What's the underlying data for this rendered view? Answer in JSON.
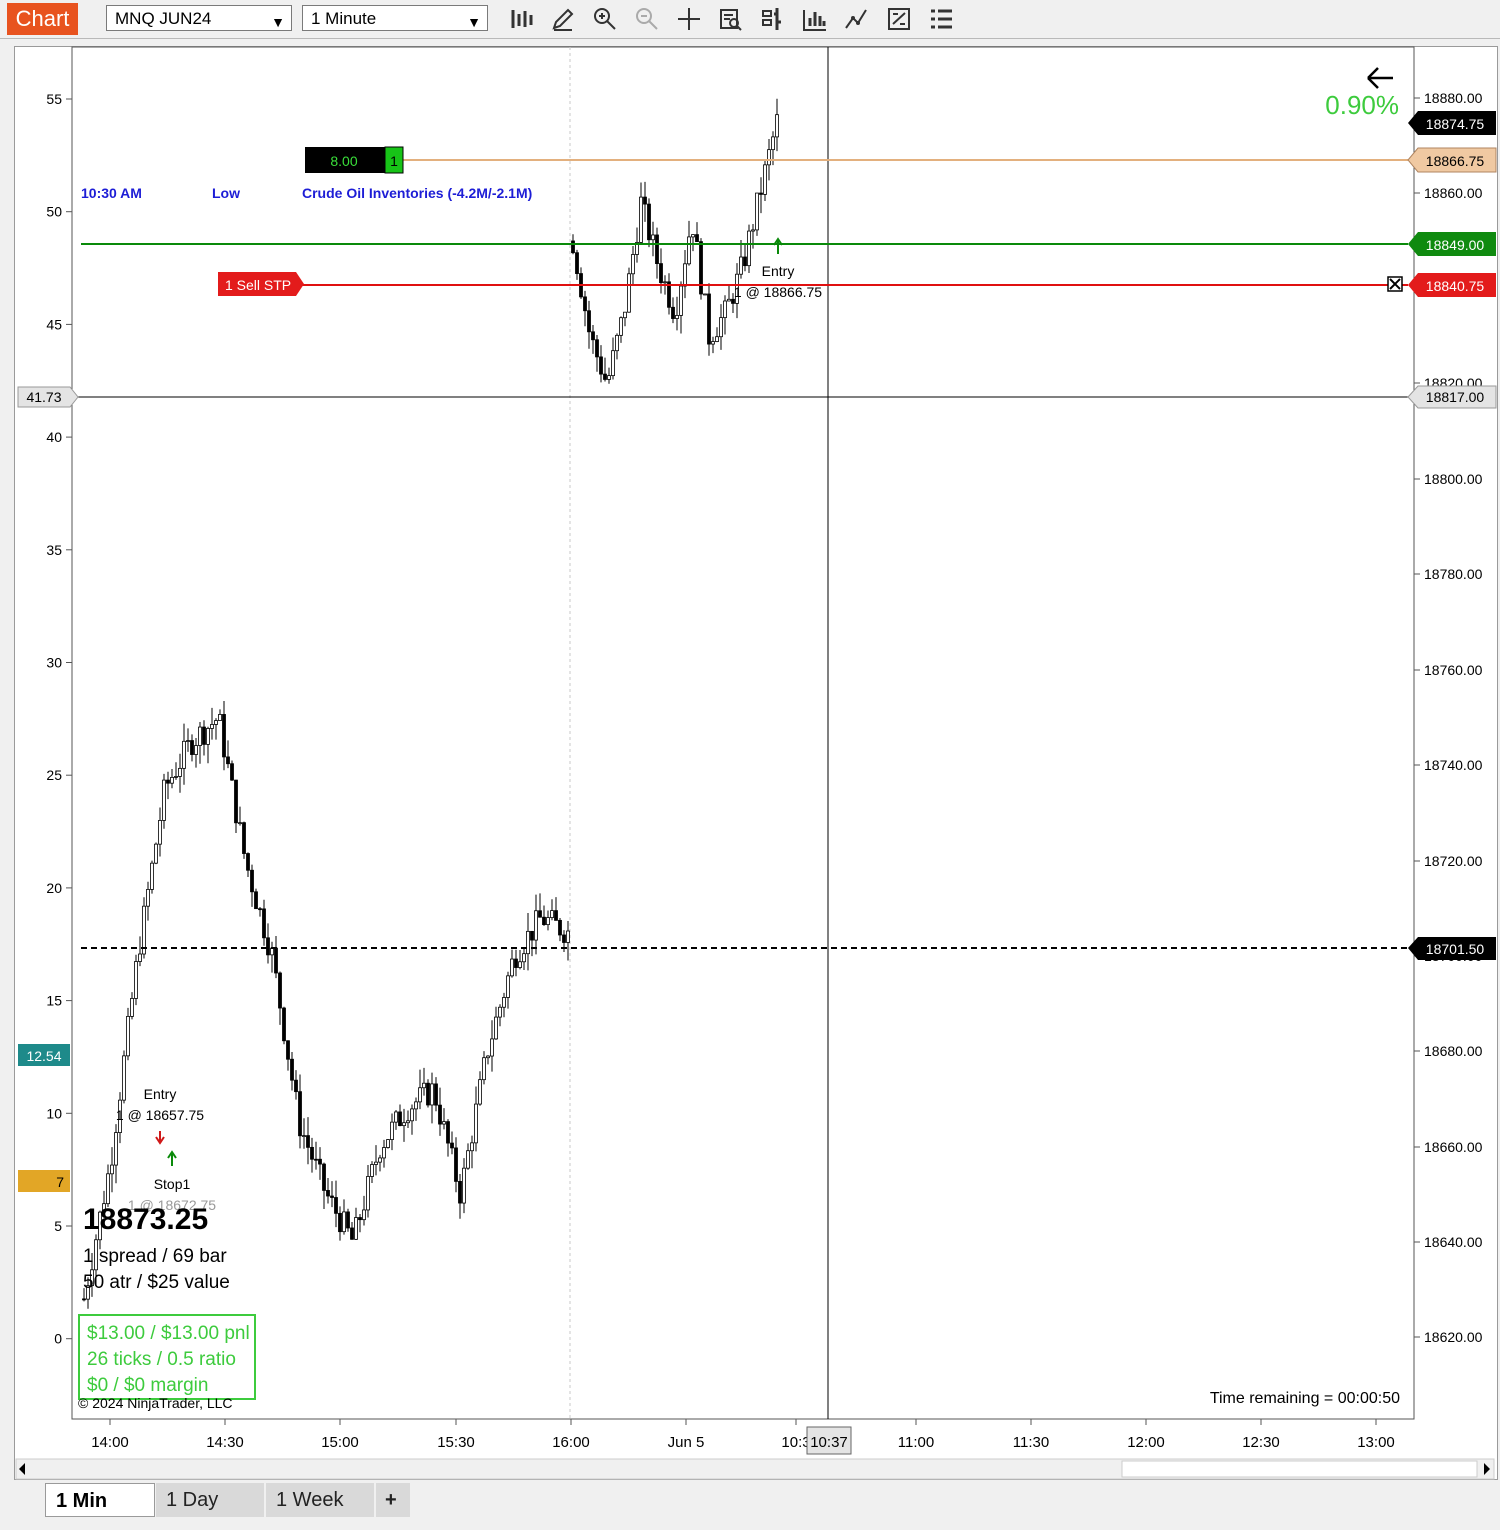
{
  "toolbar": {
    "chart_label": "Chart",
    "instrument": "MNQ JUN24",
    "interval": "1 Minute",
    "icons": [
      "bar-type-icon",
      "draw-pencil-icon",
      "zoom-in-icon",
      "zoom-out-icon",
      "crosshair-icon",
      "data-box-icon",
      "chart-style-icon",
      "volume-bars-icon",
      "indicators-icon",
      "strategies-icon",
      "properties-icon"
    ]
  },
  "chart": {
    "pct_change": "0.90%",
    "left_axis_ticks": [
      "55",
      "50",
      "45",
      "40",
      "35",
      "30",
      "25",
      "20",
      "15",
      "10",
      "5",
      "0"
    ],
    "left_markers": {
      "crosshair": "41.73",
      "teal": "12.54",
      "gold": "7"
    },
    "right_axis_ticks": [
      "18880.00",
      "18860.00",
      "18820.00",
      "18800.00",
      "18780.00",
      "18760.00",
      "18740.00",
      "18720.00",
      "18700.00",
      "18680.00",
      "18660.00",
      "18640.00",
      "18620.00"
    ],
    "right_markers": {
      "last": "18874.75",
      "target": "18866.75",
      "stop": "18849.00",
      "sell_stp": "18840.75",
      "crosshair": "18817.00",
      "prior_close": "18701.50"
    },
    "x_ticks": [
      "14:00",
      "14:30",
      "15:00",
      "15:30",
      "16:00",
      "Jun 5",
      "10:3",
      "11:00",
      "11:30",
      "12:00",
      "12:30",
      "13:00"
    ],
    "x_crosshair": "10:37",
    "news": {
      "time": "10:30 AM",
      "impact": "Low",
      "event": "Crude Oil Inventories (-4.2M/-2.1M)"
    },
    "target_order": {
      "value": "8.00",
      "qty": "1"
    },
    "stop_order": "1 Sell STP",
    "entry1": {
      "label": "Entry",
      "detail": "1 @ 18657.75"
    },
    "stop1": {
      "label": "Stop1",
      "detail": "1 @ 18672.75"
    },
    "entry2": {
      "label": "Entry",
      "detail": "1 @ 18866.75"
    },
    "price_big": "18873.25",
    "info1": "1 spread / 69 bar",
    "info2": "50 atr / $25 value",
    "pnl1": "$13.00 / $13.00 pnl",
    "pnl2": "26 ticks / 0.5 ratio",
    "pnl3": "$0 / $0 margin",
    "copyright": "© 2024 NinjaTrader, LLC",
    "time_remaining": "Time remaining = 00:00:50"
  },
  "tabs": [
    "1 Min",
    "1 Day",
    "1 Week"
  ],
  "add_tab": "+",
  "chart_data": {
    "type": "candlestick",
    "price_axis": [
      18610,
      18890
    ],
    "segments": [
      {
        "session": "Jun 4 14:00-16:00",
        "approx_path": [
          18628,
          18657,
          18700,
          18735,
          18745,
          18750,
          18720,
          18700,
          18665,
          18650,
          18640,
          18660,
          18668,
          18672,
          18650,
          18680,
          18700,
          18708,
          18705
        ]
      },
      {
        "session": "Jun 5 09:30-10:37",
        "approx_path": [
          18850,
          18830,
          18820,
          18835,
          18858,
          18845,
          18835,
          18855,
          18830,
          18835,
          18845,
          18860,
          18875
        ]
      }
    ]
  }
}
